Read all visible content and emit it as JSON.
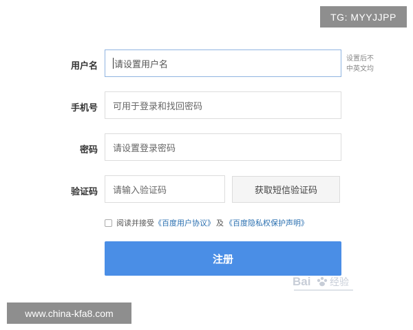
{
  "watermarks": {
    "top": "TG: MYYJJPP",
    "bottom": "www.china-kfa8.com"
  },
  "form": {
    "username": {
      "label": "用户名",
      "placeholder": "请设置用户名",
      "hint_line1": "设置后不",
      "hint_line2": "中英文均"
    },
    "phone": {
      "label": "手机号",
      "placeholder": "可用于登录和找回密码"
    },
    "password": {
      "label": "密码",
      "placeholder": "请设置登录密码"
    },
    "captcha": {
      "label": "验证码",
      "placeholder": "请输入验证码",
      "sms_button": "获取短信验证码"
    },
    "agreement": {
      "text": "阅读并接受",
      "link1": "《百度用户协议》",
      "and": "及",
      "link2": "《百度隐私权保护声明》"
    },
    "submit_label": "注册"
  },
  "logo": {
    "brand_text": "Bai",
    "brand_suffix": "经验"
  },
  "colors": {
    "primary_button": "#4a8ee6",
    "link": "#2a6fb0",
    "watermark_bg": "#8e8e8e"
  }
}
